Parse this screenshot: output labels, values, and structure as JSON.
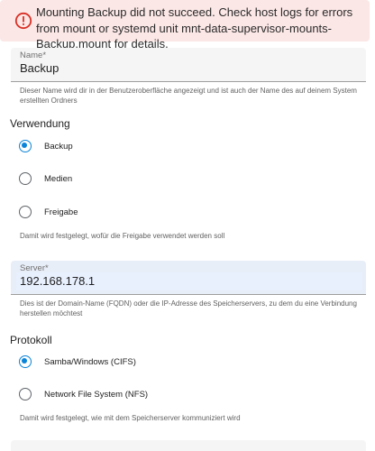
{
  "alert": {
    "icon": "error-circle-icon",
    "color": "#d93025",
    "message": "Mounting Backup did not succeed. Check host logs for errors from mount or systemd unit mnt-data-supervisor-mounts-Backup.mount for details."
  },
  "name_field": {
    "label": "Name*",
    "value": "Backup",
    "helper": "Dieser Name wird dir in der Benutzeroberfläche angezeigt und ist auch der Name des auf deinem System erstellten Ordners"
  },
  "usage": {
    "title": "Verwendung",
    "options": [
      {
        "label": "Backup",
        "checked": true
      },
      {
        "label": "Medien",
        "checked": false
      },
      {
        "label": "Freigabe",
        "checked": false
      }
    ],
    "helper": "Damit wird festgelegt, wofür die Freigabe verwendet werden soll"
  },
  "server_field": {
    "label": "Server*",
    "value": "192.168.178.1",
    "helper": "Dies ist der Domain-Name (FQDN) oder die IP-Adresse des Speicherservers, zu dem du eine Verbindung herstellen möchtest"
  },
  "protocol": {
    "title": "Protokoll",
    "options": [
      {
        "label": "Samba/Windows (CIFS)",
        "checked": true
      },
      {
        "label": "Network File System (NFS)",
        "checked": false
      }
    ],
    "helper": "Damit wird festgelegt, wie mit dem Speicherserver kommuniziert wird"
  },
  "accent_color": "#0a84d8"
}
